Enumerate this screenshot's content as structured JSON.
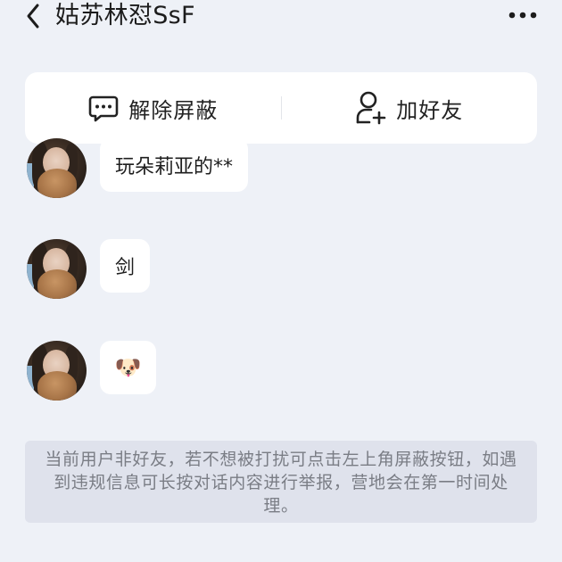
{
  "header": {
    "title": "姑苏林怼SsF",
    "back_icon": "chevron-left-icon",
    "more_icon": "more-dots-icon"
  },
  "actions": {
    "unblock_label": "解除屏蔽",
    "unblock_icon": "chat-bubble-dots-icon",
    "add_friend_label": "加好友",
    "add_friend_icon": "add-user-icon"
  },
  "messages": [
    {
      "text": "玩朵莉亚的**"
    },
    {
      "text": "剑"
    },
    {
      "text": "🐶",
      "emoji": "dog-face"
    }
  ],
  "notice": {
    "text": "当前用户非好友，若不想被打扰可点击左上角屏蔽按钮，如遇到违规信息可长按对话内容进行举报，营地会在第一时间处理。"
  },
  "colors": {
    "background": "#eef1f7",
    "card": "#ffffff",
    "notice_bg": "#dfe2ec",
    "notice_text": "#7a7d85"
  }
}
